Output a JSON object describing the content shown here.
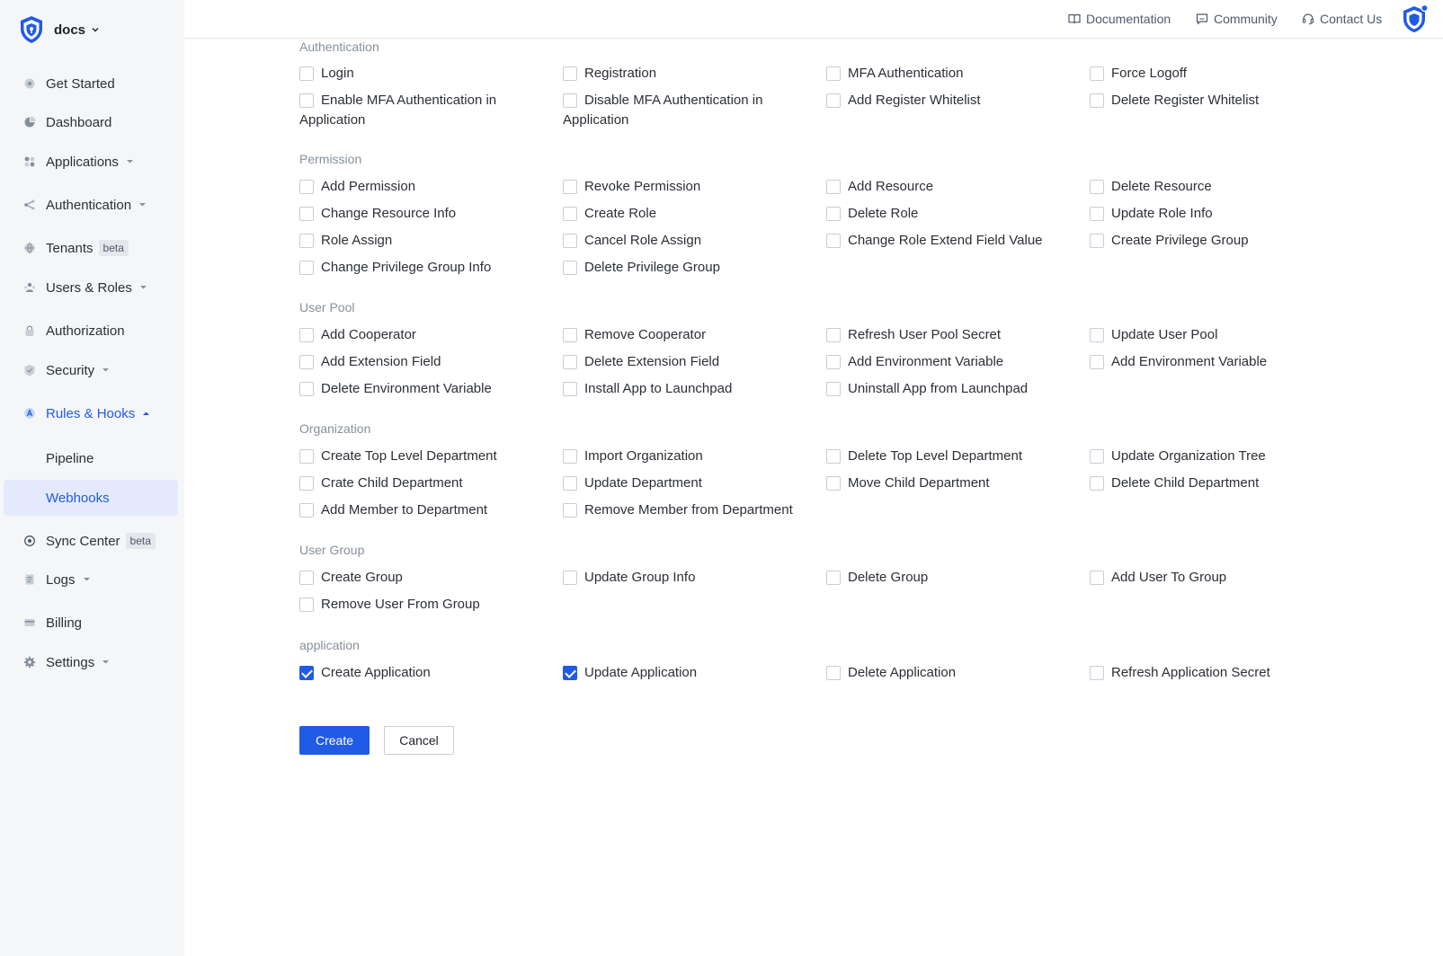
{
  "brand": {
    "name": "docs",
    "logo_icon": "shield-logo-icon"
  },
  "header": {
    "links": [
      {
        "label": "Documentation",
        "icon": "book-icon"
      },
      {
        "label": "Community",
        "icon": "chat-icon"
      },
      {
        "label": "Contact Us",
        "icon": "headset-icon"
      }
    ],
    "avatar_icon": "shield-avatar-icon"
  },
  "sidebar": {
    "items": [
      {
        "label": "Get Started",
        "icon": "rocket-icon"
      },
      {
        "label": "Dashboard",
        "icon": "pie-chart-icon"
      },
      {
        "label": "Applications",
        "icon": "apps-icon",
        "caret": "down"
      },
      {
        "label": "Authentication",
        "icon": "share-icon",
        "caret": "down"
      },
      {
        "label": "Tenants",
        "icon": "globe-icon",
        "badge": "beta"
      },
      {
        "label": "Users & Roles",
        "icon": "users-icon",
        "caret": "down"
      },
      {
        "label": "Authorization",
        "icon": "lock-icon"
      },
      {
        "label": "Security",
        "icon": "shield-icon",
        "caret": "down"
      },
      {
        "label": "Rules & Hooks",
        "icon": "hook-icon",
        "caret": "up",
        "active": true
      },
      {
        "label": "Pipeline",
        "sub": true
      },
      {
        "label": "Webhooks",
        "sub": true,
        "selected": true
      },
      {
        "label": "Sync Center",
        "icon": "sync-icon",
        "badge": "beta"
      },
      {
        "label": "Logs",
        "icon": "document-icon",
        "caret": "down"
      },
      {
        "label": "Billing",
        "icon": "card-icon"
      },
      {
        "label": "Settings",
        "icon": "gear-icon",
        "caret": "down"
      }
    ]
  },
  "sections": [
    {
      "title": "Authentication",
      "rows": [
        [
          "Login",
          "Registration",
          "MFA Authentication",
          "Force Logoff"
        ],
        [
          "Enable MFA Authentication in Application",
          "Disable MFA Authentication in Application",
          "Add Register Whitelist",
          "Delete Register Whitelist"
        ]
      ]
    },
    {
      "title": "Permission",
      "rows": [
        [
          "Add Permission",
          "Revoke Permission",
          "Add Resource",
          "Delete Resource"
        ],
        [
          "Change Resource Info",
          "Create Role",
          "Delete Role",
          "Update Role Info"
        ],
        [
          "Role Assign",
          "Cancel Role Assign",
          "Change Role Extend Field Value",
          "Create Privilege Group"
        ],
        [
          "Change Privilege Group Info",
          "Delete Privilege Group"
        ]
      ]
    },
    {
      "title": "User Pool",
      "rows": [
        [
          "Add Cooperator",
          "Remove Cooperator",
          "Refresh User Pool Secret",
          "Update User Pool"
        ],
        [
          "Add Extension Field",
          "Delete Extension Field",
          "Add Environment Variable",
          "Add Environment Variable"
        ],
        [
          "Delete Environment Variable",
          "Install App to Launchpad",
          "Uninstall App from Launchpad"
        ]
      ]
    },
    {
      "title": "Organization",
      "rows": [
        [
          "Create Top Level Department",
          "Import Organization",
          "Delete Top Level Department",
          "Update Organization Tree"
        ],
        [
          "Crate Child Department",
          "Update Department",
          "Move Child Department",
          "Delete Child Department"
        ],
        [
          "Add Member to Department",
          "Remove Member from Department"
        ]
      ]
    },
    {
      "title": "User Group",
      "rows": [
        [
          "Create Group",
          "Update Group Info",
          "Delete Group",
          "Add User To Group"
        ],
        [
          "Remove User From Group"
        ]
      ]
    },
    {
      "title": "application",
      "rows": [
        [
          "Create Application",
          "Update Application",
          "Delete Application",
          "Refresh Application Secret"
        ]
      ]
    }
  ],
  "checked": [
    "Create Application",
    "Update Application"
  ],
  "actions": {
    "create_label": "Create",
    "cancel_label": "Cancel"
  },
  "colors": {
    "accent": "#215ae5",
    "sidebar_bg": "#f5f6f8",
    "selected_bg": "#e4eafb",
    "muted": "#86909c"
  }
}
